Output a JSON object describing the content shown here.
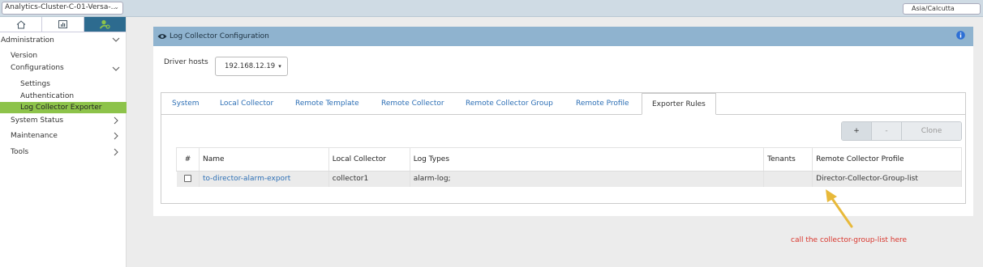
{
  "topbar": {
    "cluster_value": "Analytics-Cluster-C-01-Versa-...",
    "timezone_value": "Asia/Calcutta"
  },
  "sidebar": {
    "tabs": [
      {
        "icon": "home-icon"
      },
      {
        "icon": "bar-chart-icon"
      },
      {
        "icon": "user-settings-icon"
      }
    ],
    "items": [
      {
        "label": "Administration"
      },
      {
        "label": "Version"
      },
      {
        "label": "Configurations"
      },
      {
        "label": "Settings"
      },
      {
        "label": "Authentication"
      },
      {
        "label": "Log Collector Exporter"
      },
      {
        "label": "System Status"
      },
      {
        "label": "Maintenance"
      },
      {
        "label": "Tools"
      }
    ]
  },
  "panel": {
    "title": "Log Collector Configuration",
    "driver_hosts_label": "Driver hosts",
    "driver_hosts_value": "192.168.12.19",
    "tabs": [
      {
        "label": "System"
      },
      {
        "label": "Local Collector"
      },
      {
        "label": "Remote Template"
      },
      {
        "label": "Remote Collector"
      },
      {
        "label": "Remote Collector Group"
      },
      {
        "label": "Remote Profile"
      },
      {
        "label": "Exporter Rules"
      }
    ],
    "buttons": {
      "add": "+",
      "delete": "-",
      "clone": "Clone"
    },
    "table": {
      "columns": [
        "#",
        "Name",
        "Local Collector",
        "Log Types",
        "Tenants",
        "Remote Collector Profile"
      ],
      "rows": [
        {
          "name": "to-director-alarm-export",
          "local_collector": "collector1",
          "log_types": "alarm-log;",
          "tenants": "",
          "remote_collector_profile": "Director-Collector-Group-list"
        }
      ]
    }
  },
  "annotation": {
    "text": "call the collector-group-list here",
    "color": "#d9362d",
    "arrow_color": "#e8b93a"
  }
}
